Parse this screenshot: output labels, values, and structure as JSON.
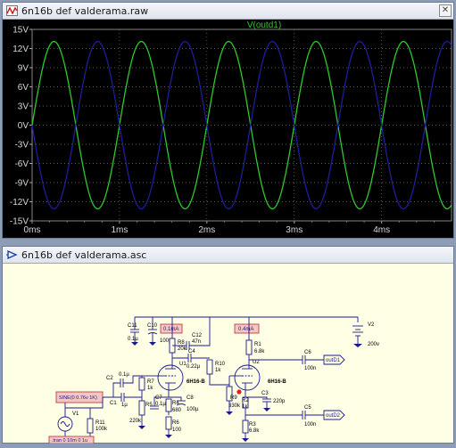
{
  "waveform_window": {
    "title": "6n16b def valderama.raw",
    "close_glyph": "✕",
    "icon": "waveform-icon"
  },
  "chart_data": {
    "type": "line",
    "title": "V(outd1)",
    "xlabel": "",
    "ylabel": "",
    "x_unit": "ms",
    "xlim": [
      0,
      4.8
    ],
    "ylim": [
      -15,
      15
    ],
    "x_ticks": [
      "0ms",
      "1ms",
      "2ms",
      "3ms",
      "4ms"
    ],
    "x_tick_values": [
      0,
      1,
      2,
      3,
      4
    ],
    "y_ticks": [
      "15V",
      "12V",
      "9V",
      "6V",
      "3V",
      "0V",
      "-3V",
      "-6V",
      "-9V",
      "-12V",
      "-15V"
    ],
    "y_tick_values": [
      15,
      12,
      9,
      6,
      3,
      0,
      -3,
      -6,
      -9,
      -12,
      -15
    ],
    "grid": true,
    "series": [
      {
        "name": "V(outd1)",
        "color": "#2ec82e",
        "amplitude": 13.1,
        "frequency_khz": 1,
        "phase": "sine"
      },
      {
        "color": "#1e1e9c",
        "amplitude": 13.1,
        "frequency_khz": 1,
        "phase": "inverted-sine"
      }
    ]
  },
  "schematic_window": {
    "title": "6n16b def valderama.asc",
    "icon": "schematic-icon",
    "labels": {
      "c11": "C11",
      "c11v": "0.1µ",
      "c10": "C10",
      "c10v": "100µ",
      "ann1": "0.1mA",
      "r8": "R8",
      "r8v": "20k",
      "c12": "C12",
      "c12v": "47n",
      "c4": "C4",
      "c4v": "0.22µ",
      "r10": "R10",
      "r10v": "1k",
      "ann2": "0.4mA",
      "r1": "R1",
      "r1v": "6.8k",
      "v2": "V2",
      "v2v": "200v",
      "u1": "U1",
      "tube1": "6H16-B",
      "u2": "U2",
      "tube2": "6H16-B",
      "c6": "C6",
      "c6v": "100n",
      "outd1": "outD1",
      "c2": "C2",
      "c2v": "0.1µ",
      "c1": "C1",
      "c1v": "1µ",
      "r7": "R7",
      "r7v": "1k",
      "r5": "R5",
      "r5v": "220k",
      "c7": "C7",
      "c7v": "0.1µ",
      "r4": "R4",
      "r4v": "680",
      "c8": "C8",
      "c8v": "100µ",
      "r6": "R6",
      "r6v": "100",
      "r9": "R9",
      "r9v": "330k",
      "r2": "R2",
      "r2v": "1k",
      "c3": "C3",
      "c3v": "220p",
      "c5": "C5",
      "c5v": "100n",
      "outd2": "outD2",
      "r3": "R3",
      "r3v": "6.8k",
      "sine": "SINE(0 0.76v 1K)",
      "v1": "V1",
      "r11": "R11",
      "r11v": "100k",
      "tran": ".tran 0 10m 0 1u"
    }
  }
}
